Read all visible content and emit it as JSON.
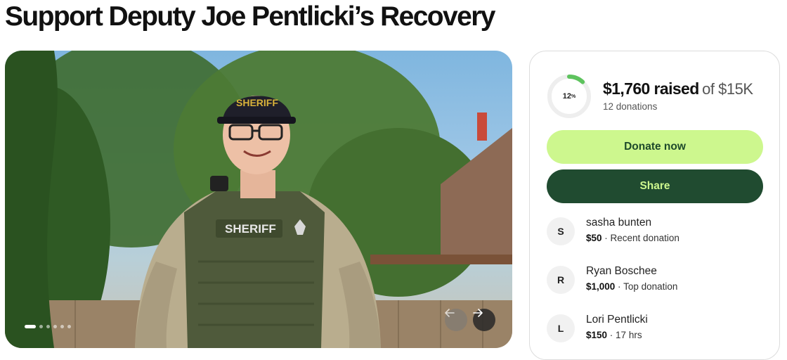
{
  "page": {
    "title": "Support Deputy Joe Pentlicki’s Recovery"
  },
  "hero": {
    "image_alt": "Smiling deputy in sheriff uniform, cap and tactical vest outdoors",
    "cap_text": "SHERIFF",
    "vest_text": "SHERIFF",
    "slide_count": 6,
    "active_slide": 1,
    "prev_icon": "arrow-left-icon",
    "next_icon": "arrow-right-icon"
  },
  "progress": {
    "percent": 12,
    "percent_label": "12",
    "percent_sign": "%",
    "raised_text": "$1,760 raised",
    "goal_text": "of $15K",
    "donations_text": "12 donations",
    "ring_color": "#5ec35e",
    "ring_track_color": "#eeeeee"
  },
  "buttons": {
    "donate_label": "Donate now",
    "share_label": "Share",
    "donate_bg": "#cdf78e",
    "share_bg": "#204b30"
  },
  "donors": [
    {
      "initial": "S",
      "name": "sasha bunten",
      "amount": "$50",
      "separator": " · ",
      "note": "Recent donation"
    },
    {
      "initial": "R",
      "name": "Ryan Boschee",
      "amount": "$1,000",
      "separator": " · ",
      "note": "Top donation"
    },
    {
      "initial": "L",
      "name": "Lori Pentlicki",
      "amount": "$150",
      "separator": " · ",
      "note": "17 hrs"
    }
  ]
}
